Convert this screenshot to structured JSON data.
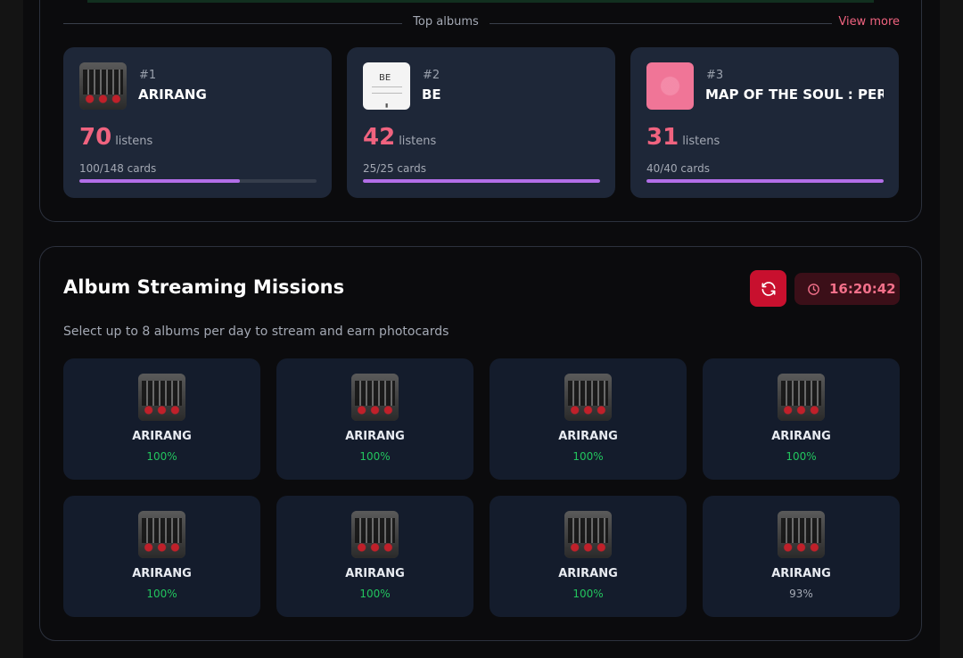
{
  "top_albums": {
    "title": "Top albums",
    "view_more": "View more",
    "albums": [
      {
        "rank": "#1",
        "name": "ARIRANG",
        "listens": "70",
        "listens_unit": "listens",
        "cards": "100/148 cards",
        "progress": 0.676
      },
      {
        "rank": "#2",
        "name": "BE",
        "listens": "42",
        "listens_unit": "listens",
        "cards": "25/25 cards",
        "progress": 1.0
      },
      {
        "rank": "#3",
        "name": "MAP OF THE SOUL : PERS...",
        "listens": "31",
        "listens_unit": "listens",
        "cards": "40/40 cards",
        "progress": 1.0
      }
    ],
    "be_cover_text": "BE"
  },
  "missions": {
    "title": "Album Streaming Missions",
    "subtitle": "Select up to 8 albums per day to stream and earn photocards",
    "timer": "16:20:42",
    "refresh_icon": "refresh-icon",
    "clock_icon": "clock-icon",
    "items": [
      {
        "name": "ARIRANG",
        "percent": "100%",
        "complete": true
      },
      {
        "name": "ARIRANG",
        "percent": "100%",
        "complete": true
      },
      {
        "name": "ARIRANG",
        "percent": "100%",
        "complete": true
      },
      {
        "name": "ARIRANG",
        "percent": "100%",
        "complete": true
      },
      {
        "name": "ARIRANG",
        "percent": "100%",
        "complete": true
      },
      {
        "name": "ARIRANG",
        "percent": "100%",
        "complete": true
      },
      {
        "name": "ARIRANG",
        "percent": "100%",
        "complete": true
      },
      {
        "name": "ARIRANG",
        "percent": "93%",
        "complete": false
      }
    ]
  },
  "colors": {
    "accent_pink": "#f0637f",
    "progress_purple": "#b26ee8",
    "complete_green": "#22c55e",
    "incomplete_gray": "#a4a9b4",
    "refresh_red": "#c8102e"
  }
}
